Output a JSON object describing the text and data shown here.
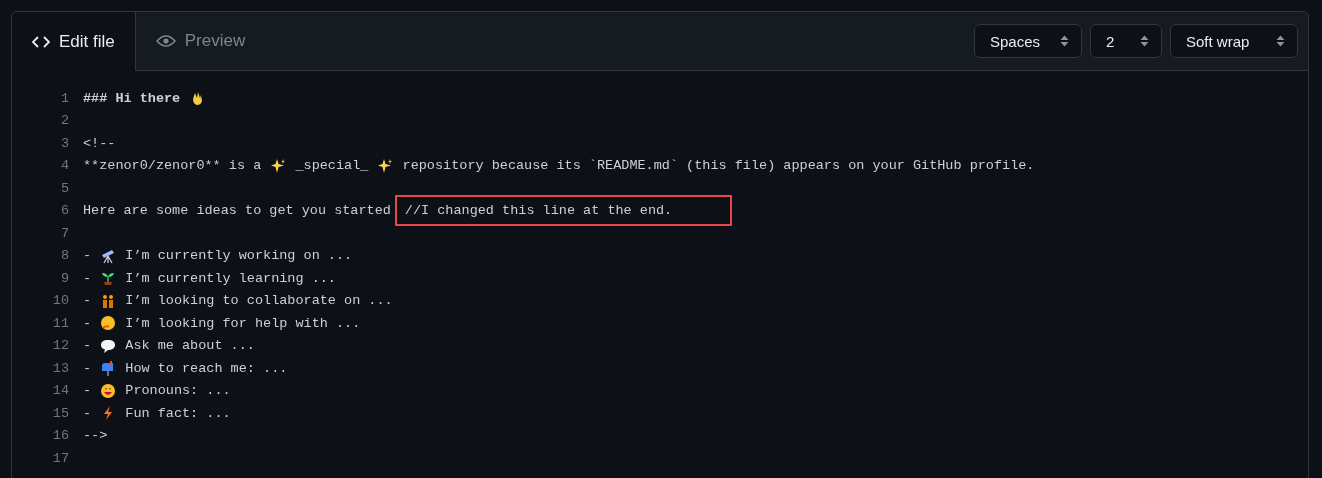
{
  "tabs": [
    {
      "label": "Edit file",
      "selected": true,
      "kind": "code"
    },
    {
      "label": "Preview",
      "selected": false,
      "kind": "eye"
    }
  ],
  "selects": [
    {
      "value": "Spaces"
    },
    {
      "value": "2"
    },
    {
      "value": "Soft wrap"
    }
  ],
  "lines": [
    {
      "number": "1",
      "segments": [
        "### Hi there "
      ],
      "bold": true
    },
    {
      "number": "2"
    },
    {
      "number": "3",
      "segments": [
        "<!--"
      ]
    },
    {
      "number": "4",
      "segments": [
        "**zenor0/zenor0** is a ",
        " _special_ ",
        " repository because its `README.md` (this file) appears on your GitHub profile."
      ]
    },
    {
      "number": "5"
    },
    {
      "number": "6",
      "segments": [
        "Here are some ideas to get you started"
      ],
      "annotation": "//I changed this line at the end."
    },
    {
      "number": "7"
    },
    {
      "number": "8",
      "segments": [
        "- ",
        " I’m currently working on ..."
      ]
    },
    {
      "number": "9",
      "segments": [
        "- ",
        " I’m currently learning ..."
      ]
    },
    {
      "number": "10",
      "segments": [
        "- ",
        " I’m looking to collaborate on ..."
      ]
    },
    {
      "number": "11",
      "segments": [
        "- ",
        " I’m looking for help with ..."
      ]
    },
    {
      "number": "12",
      "segments": [
        "- ",
        " Ask me about ..."
      ]
    },
    {
      "number": "13",
      "segments": [
        "- ",
        " How to reach me: ..."
      ]
    },
    {
      "number": "14",
      "segments": [
        "- ",
        " Pronouns: ..."
      ]
    },
    {
      "number": "15",
      "segments": [
        "- ",
        " Fun fact: ..."
      ]
    },
    {
      "number": "16",
      "segments": [
        "-->"
      ]
    },
    {
      "number": "17"
    }
  ]
}
